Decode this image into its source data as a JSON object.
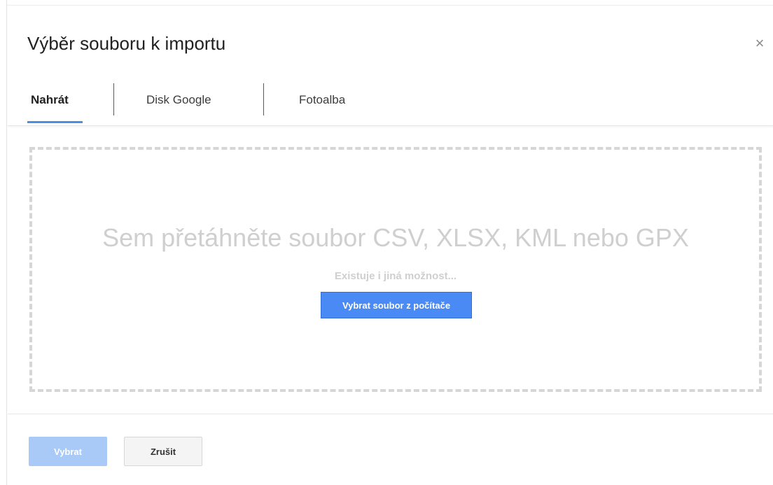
{
  "dialog": {
    "title": "Výběr souboru k importu",
    "close_label": "×"
  },
  "tabs": [
    {
      "label": "Nahrát",
      "active": true
    },
    {
      "label": "Disk Google",
      "active": false
    },
    {
      "label": "Fotoalba",
      "active": false
    }
  ],
  "dropzone": {
    "drop_text": "Sem přetáhněte soubor CSV, XLSX, KML nebo GPX",
    "alt_text": "Existuje i jiná možnost...",
    "choose_button_label": "Vybrat soubor z počítače"
  },
  "footer": {
    "select_label": "Vybrat",
    "select_disabled": true,
    "cancel_label": "Zrušit"
  },
  "colors": {
    "accent": "#4a90e2",
    "primary_button": "#4a8af4",
    "disabled_button": "#a9c9f7",
    "dashed_border": "#d6d6d6"
  },
  "icons": {
    "close": "close-icon"
  }
}
